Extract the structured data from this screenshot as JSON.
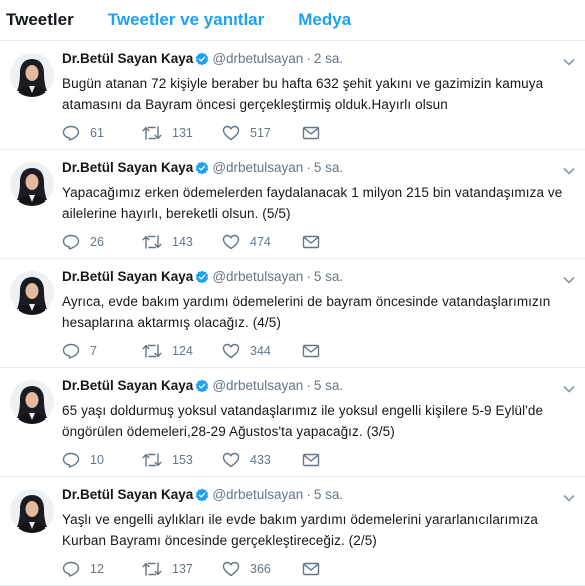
{
  "tabs": [
    {
      "label": "Tweetler",
      "active": true
    },
    {
      "label": "Tweetler ve yanıtlar",
      "active": false
    },
    {
      "label": "Medya",
      "active": false
    }
  ],
  "colors": {
    "accent": "#1da1f2",
    "text": "#14171a",
    "muted": "#657786",
    "divider": "#e6ecf0"
  },
  "tweets": [
    {
      "name": "Dr.Betül Sayan Kaya",
      "handle": "@drbetulsayan",
      "time": "2 sa.",
      "text": "Bugün atanan 72 kişiyle beraber bu hafta 632 şehit yakını ve gazimizin kamuya atamasını da Bayram öncesi gerçekleştirmiş olduk.Hayırlı olsun",
      "replies": "61",
      "retweets": "131",
      "likes": "517"
    },
    {
      "name": "Dr.Betül Sayan Kaya",
      "handle": "@drbetulsayan",
      "time": "5 sa.",
      "text": "Yapacağımız erken ödemelerden faydalanacak 1 milyon 215 bin vatandaşımıza ve ailelerine hayırlı, bereketli olsun. (5/5)",
      "replies": "26",
      "retweets": "143",
      "likes": "474"
    },
    {
      "name": "Dr.Betül Sayan Kaya",
      "handle": "@drbetulsayan",
      "time": "5 sa.",
      "text": "Ayrıca, evde bakım yardımı ödemelerini de bayram öncesinde vatandaşlarımızın hesaplarına aktarmış olacağız. (4/5)",
      "replies": "7",
      "retweets": "124",
      "likes": "344"
    },
    {
      "name": "Dr.Betül Sayan Kaya",
      "handle": "@drbetulsayan",
      "time": "5 sa.",
      "text": "65 yaşı doldurmuş yoksul vatandaşlarımız ile yoksul engelli kişilere 5-9 Eylül'de öngörülen ödemeleri,28-29 Ağustos'ta yapacağız. (3/5)",
      "replies": "10",
      "retweets": "153",
      "likes": "433"
    },
    {
      "name": "Dr.Betül Sayan Kaya",
      "handle": "@drbetulsayan",
      "time": "5 sa.",
      "text": "Yaşlı ve engelli aylıkları ile evde bakım yardımı ödemelerini yararlanıcılarımıza Kurban Bayramı öncesinde gerçekleştireceğiz. (2/5)",
      "replies": "12",
      "retweets": "137",
      "likes": "366"
    }
  ]
}
